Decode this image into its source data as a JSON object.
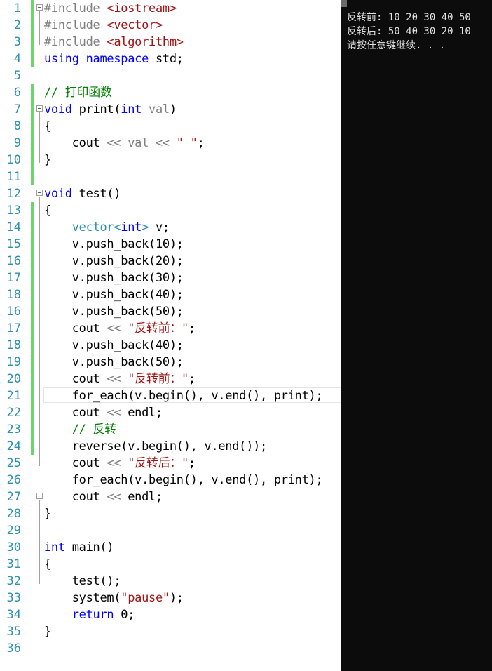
{
  "editor": {
    "lines": [
      {
        "n": "1",
        "segs": [
          {
            "t": "#include ",
            "c": "pp"
          },
          {
            "t": "<iostream>",
            "c": "inc"
          }
        ]
      },
      {
        "n": "2",
        "segs": [
          {
            "t": "#include ",
            "c": "pp"
          },
          {
            "t": "<vector>",
            "c": "inc"
          }
        ]
      },
      {
        "n": "3",
        "segs": [
          {
            "t": "#include ",
            "c": "pp"
          },
          {
            "t": "<algorithm>",
            "c": "inc"
          }
        ]
      },
      {
        "n": "4",
        "segs": [
          {
            "t": "using",
            "c": "kw"
          },
          {
            "t": " "
          },
          {
            "t": "namespace",
            "c": "kw"
          },
          {
            "t": " std;"
          }
        ]
      },
      {
        "n": "5",
        "segs": []
      },
      {
        "n": "6",
        "segs": [
          {
            "t": "// 打印函数",
            "c": "cm"
          }
        ]
      },
      {
        "n": "7",
        "segs": [
          {
            "t": "void",
            "c": "kw"
          },
          {
            "t": " print("
          },
          {
            "t": "int",
            "c": "kw"
          },
          {
            "t": " "
          },
          {
            "t": "val",
            "c": "par"
          },
          {
            "t": ")"
          }
        ]
      },
      {
        "n": "8",
        "segs": [
          {
            "t": "{"
          }
        ]
      },
      {
        "n": "9",
        "segs": [
          {
            "t": "    cout "
          },
          {
            "t": "<<",
            "c": "par"
          },
          {
            "t": " "
          },
          {
            "t": "val",
            "c": "par"
          },
          {
            "t": " "
          },
          {
            "t": "<<",
            "c": "par"
          },
          {
            "t": " "
          },
          {
            "t": "\" \"",
            "c": "str"
          },
          {
            "t": ";"
          }
        ]
      },
      {
        "n": "10",
        "segs": [
          {
            "t": "}"
          }
        ]
      },
      {
        "n": "11",
        "segs": []
      },
      {
        "n": "12",
        "segs": [
          {
            "t": "void",
            "c": "kw"
          },
          {
            "t": " test()"
          }
        ]
      },
      {
        "n": "13",
        "segs": [
          {
            "t": "{"
          }
        ]
      },
      {
        "n": "14",
        "segs": [
          {
            "t": "    "
          },
          {
            "t": "vector",
            "c": "ty"
          },
          {
            "t": "<",
            "c": "ty"
          },
          {
            "t": "int",
            "c": "kw"
          },
          {
            "t": ">",
            "c": "ty"
          },
          {
            "t": " v;"
          }
        ]
      },
      {
        "n": "15",
        "segs": [
          {
            "t": "    v.push_back(10);"
          }
        ]
      },
      {
        "n": "16",
        "segs": [
          {
            "t": "    v.push_back(20);"
          }
        ]
      },
      {
        "n": "17",
        "segs": [
          {
            "t": "    v.push_back(30);"
          }
        ]
      },
      {
        "n": "18",
        "segs": [
          {
            "t": "    v.push_back(40);"
          }
        ]
      },
      {
        "n": "16",
        "segs": [
          {
            "t": "    v.push_back(50);"
          }
        ]
      },
      {
        "n": "17",
        "segs": [
          {
            "t": "    cout "
          },
          {
            "t": "<<",
            "c": "par"
          },
          {
            "t": " "
          },
          {
            "t": "\"反转前：\"",
            "c": "str"
          },
          {
            "t": ";"
          }
        ]
      },
      {
        "n": "18",
        "segs": [
          {
            "t": "    v.push_back(40);"
          }
        ]
      },
      {
        "n": "19",
        "segs": [
          {
            "t": "    v.push_back(50);"
          }
        ]
      },
      {
        "n": "20",
        "segs": [
          {
            "t": "    cout "
          },
          {
            "t": "<<",
            "c": "par"
          },
          {
            "t": " "
          },
          {
            "t": "\"反转前：\"",
            "c": "str"
          },
          {
            "t": ";"
          }
        ]
      },
      {
        "n": "21",
        "segs": [
          {
            "t": "    for_each(v.begin(), v.end(), print);"
          }
        ]
      },
      {
        "n": "22",
        "segs": [
          {
            "t": "    cout "
          },
          {
            "t": "<<",
            "c": "par"
          },
          {
            "t": " endl;"
          }
        ]
      },
      {
        "n": "23",
        "segs": [
          {
            "t": "    "
          },
          {
            "t": "// 反转",
            "c": "cm"
          }
        ]
      },
      {
        "n": "24",
        "segs": [
          {
            "t": "    reverse(v.begin(), v.end());"
          }
        ]
      },
      {
        "n": "25",
        "segs": [
          {
            "t": "    cout "
          },
          {
            "t": "<<",
            "c": "par"
          },
          {
            "t": " "
          },
          {
            "t": "\"反转后：\"",
            "c": "str"
          },
          {
            "t": ";"
          }
        ]
      },
      {
        "n": "26",
        "segs": [
          {
            "t": "    for_each(v.begin(), v.end(), print);"
          }
        ]
      },
      {
        "n": "27",
        "segs": [
          {
            "t": "    cout "
          },
          {
            "t": "<<",
            "c": "par"
          },
          {
            "t": " endl;"
          }
        ]
      },
      {
        "n": "28",
        "segs": [
          {
            "t": "}"
          }
        ]
      },
      {
        "n": "29",
        "segs": []
      },
      {
        "n": "30",
        "segs": [
          {
            "t": "int",
            "c": "kw"
          },
          {
            "t": " main()"
          }
        ]
      },
      {
        "n": "31",
        "segs": [
          {
            "t": "{"
          }
        ]
      },
      {
        "n": "32",
        "segs": [
          {
            "t": "    test();"
          }
        ]
      },
      {
        "n": "33",
        "segs": [
          {
            "t": "    system("
          },
          {
            "t": "\"pause\"",
            "c": "str"
          },
          {
            "t": ");"
          }
        ]
      },
      {
        "n": "34",
        "segs": [
          {
            "t": "    "
          },
          {
            "t": "return",
            "c": "kw"
          },
          {
            "t": " 0;"
          }
        ]
      },
      {
        "n": "35",
        "segs": [
          {
            "t": "}"
          }
        ]
      },
      {
        "n": "36",
        "segs": []
      }
    ]
  },
  "console": {
    "lines": [
      "反转前: 10 20 30 40 50",
      "反转后: 50 40 30 20 10",
      "请按任意键继续. . ."
    ]
  },
  "colors": {
    "keyword": "#0000ff",
    "type": "#2b91af",
    "string": "#a31515",
    "comment": "#008000",
    "console_bg": "#0c0c0c",
    "change_bar": "#6fd36f"
  }
}
